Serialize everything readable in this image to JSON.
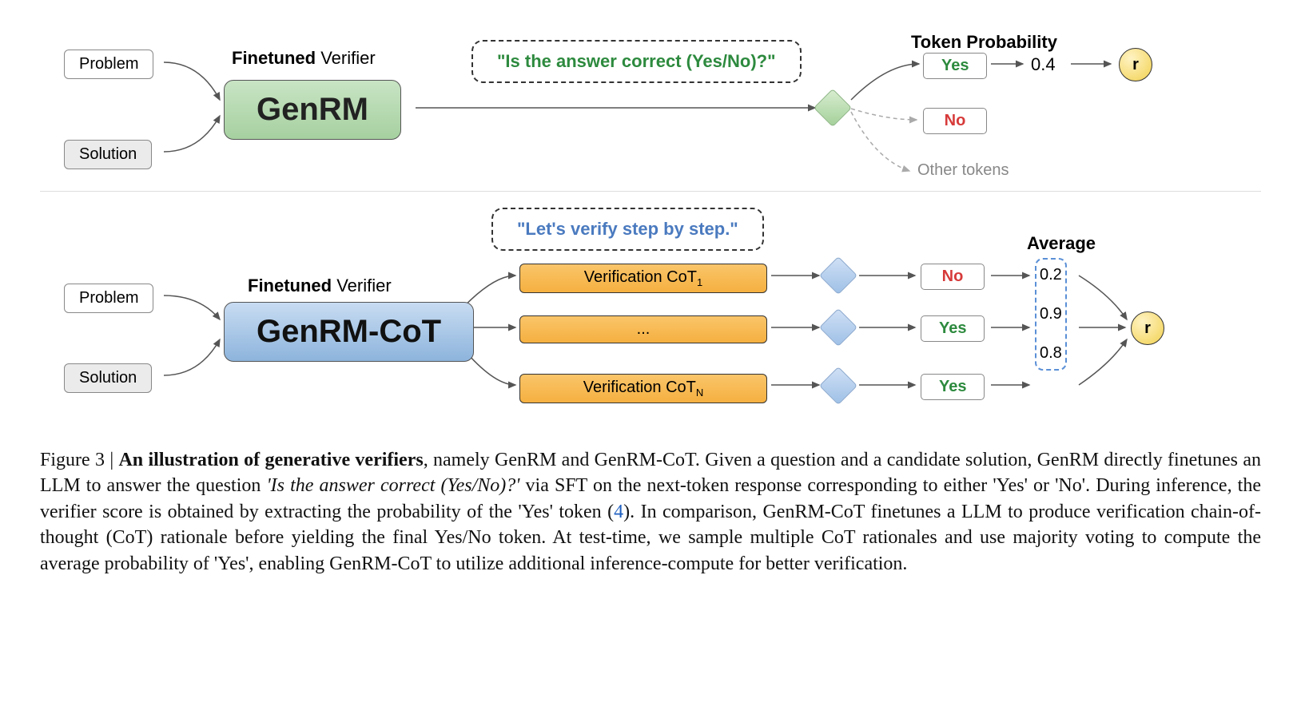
{
  "top": {
    "problem": "Problem",
    "solution": "Solution",
    "verifier_label_bold": "Finetuned",
    "verifier_label_reg": " Verifier",
    "rm_name": "GenRM",
    "speech": "\"Is the answer correct (Yes/No)?\"",
    "token_prob_title": "Token Probability",
    "yes": "Yes",
    "no": "No",
    "other": "Other tokens",
    "prob": "0.4",
    "r": "r"
  },
  "bottom": {
    "problem": "Problem",
    "solution": "Solution",
    "verifier_label_bold": "Finetuned",
    "verifier_label_reg": " Verifier",
    "rm_name": "GenRM-CoT",
    "speech": "\"Let's verify step by step.\"",
    "cot1_pre": "Verification CoT",
    "cot1_sub": "1",
    "cot_mid": "...",
    "cotN_pre": "Verification CoT",
    "cotN_sub": "N",
    "avg_title": "Average",
    "no": "No",
    "yes1": "Yes",
    "yes2": "Yes",
    "scores": {
      "s1": "0.2",
      "s2": "0.9",
      "s3": "0.8"
    },
    "r": "r"
  },
  "caption": {
    "fig": "Figure 3",
    "sep": " | ",
    "title_bold": "An illustration of generative verifiers",
    "body1": ", namely GenRM and GenRM-CoT. Given a question and a candidate solution, GenRM directly finetunes an LLM to answer the question ",
    "q_it": "'Is the answer correct (Yes/No)?'",
    "body2": " via SFT on the next-token response corresponding to either 'Yes' or 'No'. During inference, the verifier score is obtained by extracting the probability of the 'Yes' token (",
    "ref": "4",
    "body3": "). In comparison, GenRM-CoT finetunes a LLM to produce verification chain-of-thought (CoT) rationale before yielding the final Yes/No token. At test-time, we sample multiple CoT rationales and use majority voting to compute the average probability of 'Yes', enabling GenRM-CoT to utilize additional inference-compute for better verification."
  }
}
